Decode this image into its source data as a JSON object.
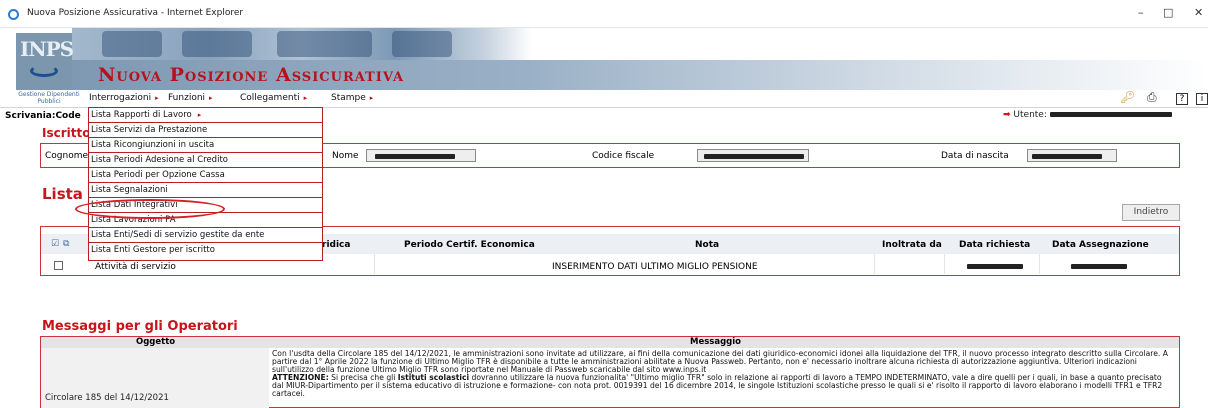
{
  "window": {
    "title": "Nuova Posizione Assicurativa - Internet Explorer",
    "minimize": "–",
    "maximize": "□",
    "close": "✕"
  },
  "banner": {
    "logo_text": "INPS",
    "app_title": "Nuova Posizione Assicurativa",
    "gestione_label": "Gestione Dipendenti Pubblici"
  },
  "menu": {
    "items": [
      "Interrogazioni",
      "Funzioni",
      "Collegamenti",
      "Stampe"
    ],
    "arrow": "▸"
  },
  "breadcrumb": "Scrivania:Code",
  "utente_label": "Utente:",
  "iscritto": {
    "title": "Iscritto",
    "cognome_label": "Cognome",
    "nome_label": "Nome",
    "cf_label": "Codice fiscale",
    "nascita_label": "Data di nascita"
  },
  "list_title": "Lista",
  "indietro_label": "Indietro",
  "table": {
    "headers": [
      "ridica",
      "Periodo Certif. Economica",
      "Nota",
      "Inoltrata da",
      "Data richiesta",
      "Data Assegnazione"
    ],
    "row": {
      "tipo": "Attività di servizio",
      "nota": "INSERIMENTO DATI ULTIMO MIGLIO PENSIONE"
    }
  },
  "dropdown": {
    "items": [
      "Lista Rapporti di Lavoro",
      "Lista Servizi da Prestazione",
      "Lista Ricongiunzioni in uscita",
      "Lista Periodi Adesione al Credito",
      "Lista Periodi per Opzione Cassa",
      "Lista Segnalazioni",
      "Lista Dati Integrativi",
      "Lista Lavorazioni PA",
      "Lista Enti/Sedi di servizio gestite da ente",
      "Lista Enti Gestore per iscritto"
    ],
    "highlighted_index": 6
  },
  "messages": {
    "title": "Messaggi per gli Operatori",
    "col_oggetto": "Oggetto",
    "col_messaggio": "Messaggio",
    "oggetto": "Circolare 185 del 14/12/2021",
    "paragraph1": "Con l'usdta della Circolare 185 del 14/12/2021, le amministrazioni sono invitate ad utilizzare, ai fini della comunicazione dei dati giuridico-economici idonei alla liquidazione del TFR, il nuovo processo integrato descritto sulla Circolare. A partire dal 1° Aprile 2022 la funzione di Ultimo Miglio TFR è disponibile a tutte le amministrazioni abilitate a Nuova Passweb. Pertanto, non e' necessario inoltrare alcuna richiesta di autorizzazione aggiuntiva. Ulteriori indicazioni sull'utilizzo della funzione Ultimo Miglio TFR sono riportate nel Manuale di Passweb scaricabile dal sito www.inps.it",
    "attenzione": "ATTENZIONE:",
    "paragraph2a": " Si precisa che gli ",
    "istituti": "Istituti scolastici",
    "paragraph2b": " dovranno utilizzare la nuova funzionalita' \"Ultimo miglio TFR\" solo in relazione ai rapporti di lavoro a TEMPO INDETERMINATO, vale a dire quelli per i quali, in base a quanto precisato dal MIUR-Dipartimento per il sistema educativo di istruzione e formazione- con nota prot. 0019391 del 16 dicembre 2014, le singole Istituzioni scolastiche presso le quali si e' risolto il rapporto di lavoro elaborano i modelli TFR1 e TFR2 cartacei."
  },
  "colors": {
    "accent_red": "#c8141c",
    "banner_blue": "#8fa7bf"
  }
}
